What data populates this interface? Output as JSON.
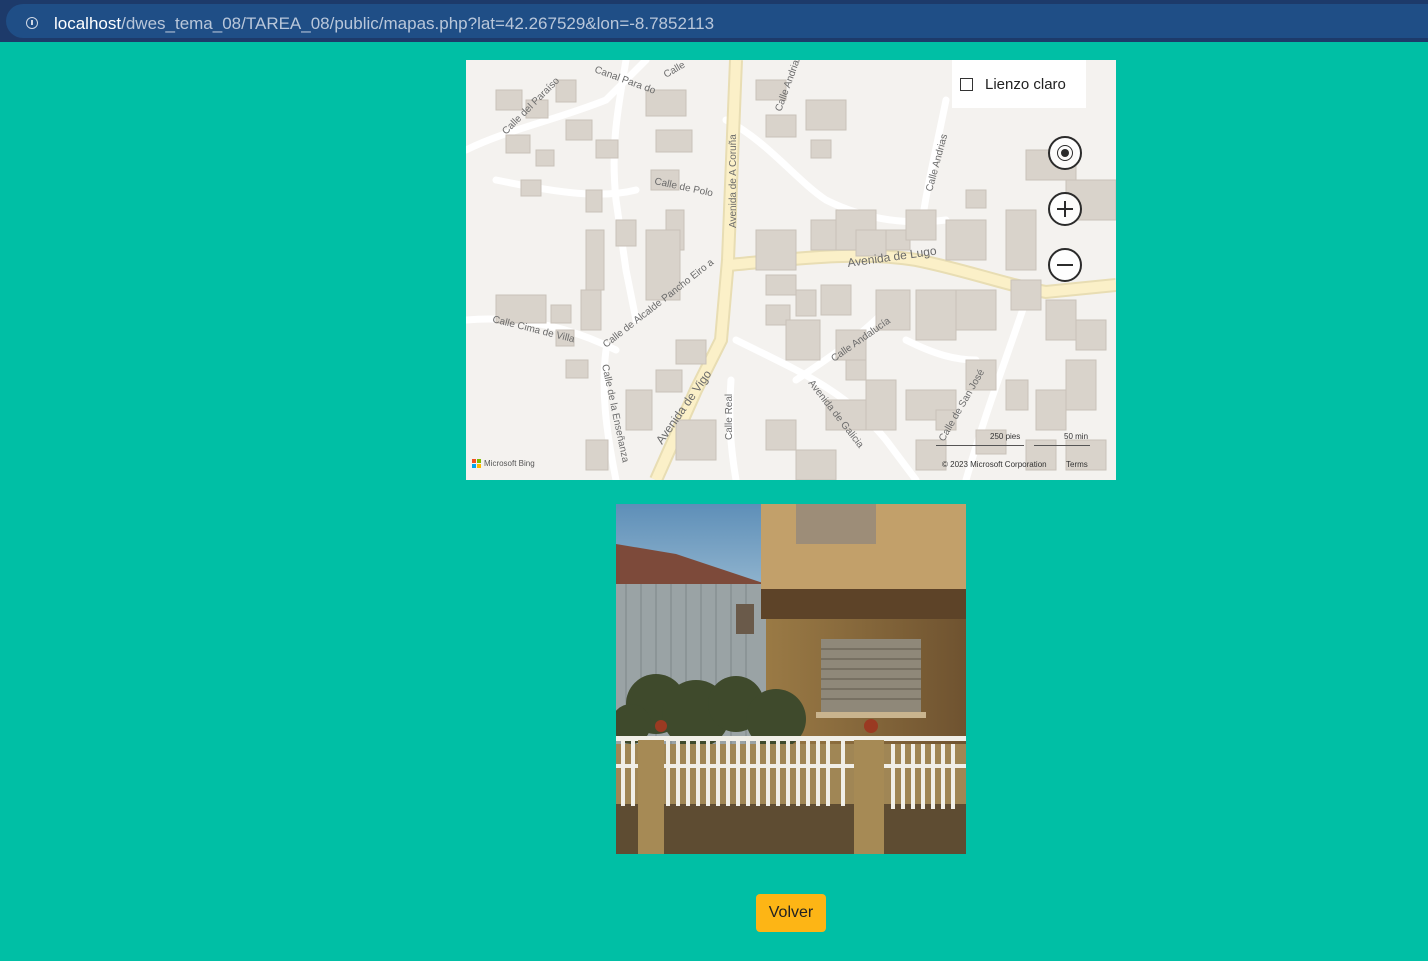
{
  "browser": {
    "url_host": "localhost",
    "url_path": "/dwes_tema_08/TAREA_08/public/mapas.php?lat=42.267529&lon=-8.7852113"
  },
  "map": {
    "canvas_toggle_label": "Lienzo claro",
    "canvas_toggle_checked": false,
    "street_labels": [
      "Calle del Paraíso",
      "Canal Para do",
      "Calle",
      "Calle Andrias",
      "Avenida de A Coruña",
      "Calle de Polo",
      "Calle Andrias",
      "Avenida de Lugo",
      "Calle de Alcalde Pancho Eiro a",
      "Calle Cima de Villa",
      "Calle Andalucía",
      "Avenida de Vigo",
      "Calle de la Enseñanza",
      "Calle Real",
      "Avenida de Galicia",
      "Calle de San José"
    ],
    "scale_feet_label": "250 pies",
    "scale_time_label": "50 min",
    "provider_label": "Microsoft Bing",
    "copyright": "© 2023 Microsoft Corporation",
    "terms_label": "Terms"
  },
  "actions": {
    "back_label": "Volver"
  },
  "colors": {
    "page_background": "#00bfa5",
    "button_background": "#fdb515",
    "address_bar": "#1f4e86",
    "road_major": "#fbf0c8"
  }
}
